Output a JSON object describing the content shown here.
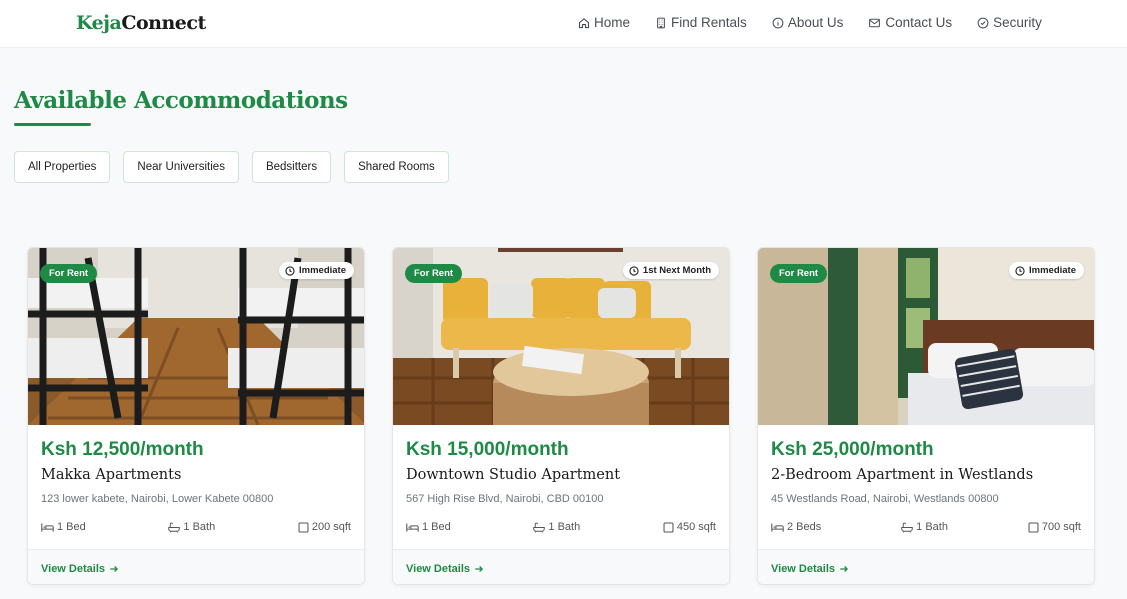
{
  "brand": {
    "part1": "Keja",
    "part2": "Connect"
  },
  "nav": [
    {
      "label": "Home",
      "icon": "home-icon"
    },
    {
      "label": "Find Rentals",
      "icon": "building-icon"
    },
    {
      "label": "About Us",
      "icon": "info-icon"
    },
    {
      "label": "Contact Us",
      "icon": "envelope-icon"
    },
    {
      "label": "Security",
      "icon": "shield-check-icon"
    }
  ],
  "section": {
    "title": "Available Accommodations"
  },
  "filters": [
    "All Properties",
    "Near Universities",
    "Bedsitters",
    "Shared Rooms"
  ],
  "colors": {
    "brand_green": "#1e8a45",
    "background": "#f8f9fa"
  },
  "listings": [
    {
      "badge": "For Rent",
      "availability": "Immediate",
      "price": "Ksh 12,500/month",
      "name": "Makka Apartments",
      "address": "123 lower kabete, Nairobi, Lower Kabete 00800",
      "beds": "1 Bed",
      "baths": "1 Bath",
      "area": "200 sqft",
      "link": "View Details"
    },
    {
      "badge": "For Rent",
      "availability": "1st Next Month",
      "price": "Ksh 15,000/month",
      "name": "Downtown Studio Apartment",
      "address": "567 High Rise Blvd, Nairobi, CBD 00100",
      "beds": "1 Bed",
      "baths": "1 Bath",
      "area": "450 sqft",
      "link": "View Details"
    },
    {
      "badge": "For Rent",
      "availability": "Immediate",
      "price": "Ksh 25,000/month",
      "name": "2-Bedroom Apartment in Westlands",
      "address": "45 Westlands Road, Nairobi, Westlands 00800",
      "beds": "2 Beds",
      "baths": "1 Bath",
      "area": "700 sqft",
      "link": "View Details"
    }
  ]
}
